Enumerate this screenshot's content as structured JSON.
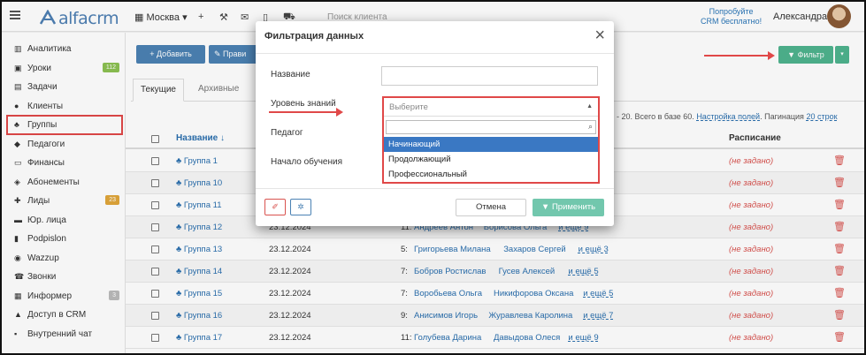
{
  "topbar": {
    "logo": "alfacrm",
    "branch": "Москва",
    "search_placeholder": "Поиск клиента",
    "promo_line1": "Попробуйте",
    "promo_line2": "CRM бесплатно!",
    "user_name": "Александра"
  },
  "sidebar": {
    "items": [
      {
        "label": "Аналитика",
        "icon": "chart-icon"
      },
      {
        "label": "Уроки",
        "icon": "calendar-icon",
        "badge": "112",
        "badge_color": "#8cc152"
      },
      {
        "label": "Задачи",
        "icon": "tasks-icon"
      },
      {
        "label": "Клиенты",
        "icon": "user-icon"
      },
      {
        "label": "Группы",
        "icon": "users-icon"
      },
      {
        "label": "Педагоги",
        "icon": "graduation-cap-icon"
      },
      {
        "label": "Финансы",
        "icon": "money-icon"
      },
      {
        "label": "Абонементы",
        "icon": "tag-icon"
      },
      {
        "label": "Лиды",
        "icon": "user-plus-icon",
        "badge": "23",
        "badge_color": "#e0a63a"
      },
      {
        "label": "Юр. лица",
        "icon": "briefcase-icon"
      },
      {
        "label": "Podpislon",
        "icon": "file-icon"
      },
      {
        "label": "Wazzup",
        "icon": "whatsapp-icon"
      },
      {
        "label": "Звонки",
        "icon": "phone-icon"
      },
      {
        "label": "Информер",
        "icon": "inbox-icon",
        "badge": "3",
        "badge_color": "#bbbbbb"
      },
      {
        "label": "Доступ в CRM",
        "icon": "lock-icon"
      },
      {
        "label": "Внутренний чат",
        "icon": "chat-icon"
      }
    ]
  },
  "toolbar": {
    "add_label": "+ Добавить",
    "edit_label": "✎ Прави",
    "filter_label": "▼ Фильтр"
  },
  "tabs": {
    "current": "Текущие",
    "archive": "Архивные"
  },
  "paging": {
    "prefix": "- 20. Всего в базе 60.",
    "fields_link": "Настройка полей",
    "pagination_label": "Пагинация",
    "pagination_link": "20 строк"
  },
  "table": {
    "col_name": "Название ↓",
    "col_schedule": "Расписание",
    "rows": [
      {
        "name": "Группа 1",
        "date": "",
        "count": "",
        "students": [],
        "more": "",
        "schedule": "(не задано)"
      },
      {
        "name": "Группа 10",
        "date": "",
        "count": "",
        "students": [],
        "more": "",
        "schedule": "(не задано)"
      },
      {
        "name": "Группа 11",
        "date": "",
        "count": "",
        "students": [],
        "more": "",
        "schedule": "(не задано)"
      },
      {
        "name": "Группа 12",
        "date": "23.12.2024",
        "count": "11:",
        "students": [
          "Андреев Антон",
          "Борисова Ольга"
        ],
        "more": "и ещё 9",
        "schedule": "(не задано)"
      },
      {
        "name": "Группа 13",
        "date": "23.12.2024",
        "count": "5:",
        "students": [
          "Григорьева Милана",
          "Захаров Сергей"
        ],
        "more": "и ещё 3",
        "schedule": "(не задано)"
      },
      {
        "name": "Группа 14",
        "date": "23.12.2024",
        "count": "7:",
        "students": [
          "Бобров Ростислав",
          "Гусев Алексей"
        ],
        "more": "и ещё 5",
        "schedule": "(не задано)"
      },
      {
        "name": "Группа 15",
        "date": "23.12.2024",
        "count": "7:",
        "students": [
          "Воробьева Ольга",
          "Никифорова Оксана"
        ],
        "more": "и ещё 5",
        "schedule": "(не задано)"
      },
      {
        "name": "Группа 16",
        "date": "23.12.2024",
        "count": "9:",
        "students": [
          "Анисимов Игорь",
          "Журавлева Каролина"
        ],
        "more": "и ещё 7",
        "schedule": "(не задано)"
      },
      {
        "name": "Группа 17",
        "date": "23.12.2024",
        "count": "11:",
        "students": [
          "Голубева Дарина",
          "Давыдова Олеся"
        ],
        "more": "и ещё 9",
        "schedule": "(не задано)"
      }
    ]
  },
  "modal": {
    "title": "Фильтрация данных",
    "field_name": "Название",
    "field_level": "Уровень знаний",
    "field_teacher": "Педагог",
    "field_start": "Начало обучения",
    "select_placeholder": "Выберите",
    "options": [
      "Начинающий",
      "Продолжающий",
      "Профессиональный"
    ],
    "selected_option": "Начинающий",
    "cancel_label": "Отмена",
    "apply_label": "▼ Применить"
  },
  "colors": {
    "brand": "#4e7fb3",
    "primary": "#4b82b4",
    "success": "#4fb38e",
    "danger": "#d9534f",
    "highlight": "#e04848"
  }
}
